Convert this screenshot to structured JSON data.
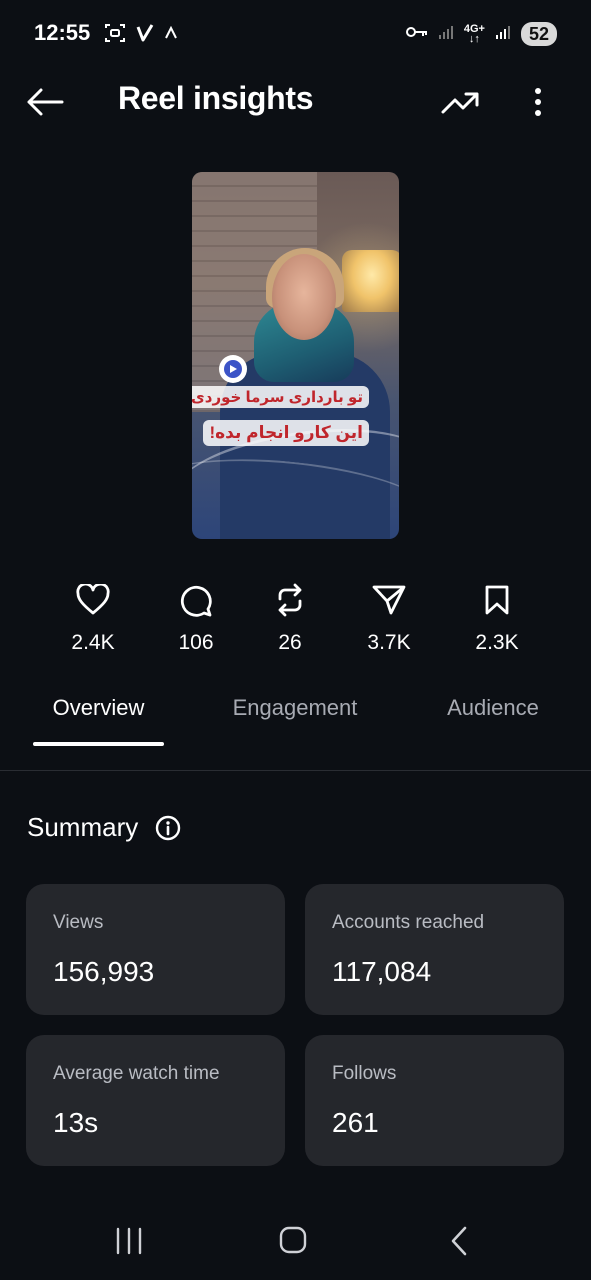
{
  "status_bar": {
    "time": "12:55",
    "network": "4G+",
    "battery": "52"
  },
  "header": {
    "title": "Reel insights"
  },
  "thumbnail": {
    "caption_line1": "تو بارداری سرما خوردی؟",
    "caption_line2": "این کارو انجام بده!"
  },
  "stats": [
    {
      "icon": "heart-icon",
      "value": "2.4K"
    },
    {
      "icon": "comment-icon",
      "value": "106"
    },
    {
      "icon": "repost-icon",
      "value": "26"
    },
    {
      "icon": "share-icon",
      "value": "3.7K"
    },
    {
      "icon": "bookmark-icon",
      "value": "2.3K"
    }
  ],
  "tabs": [
    {
      "label": "Overview",
      "active": true
    },
    {
      "label": "Engagement",
      "active": false
    },
    {
      "label": "Audience",
      "active": false
    }
  ],
  "summary": {
    "title": "Summary",
    "cards": [
      {
        "label": "Views",
        "value": "156,993"
      },
      {
        "label": "Accounts reached",
        "value": "117,084"
      },
      {
        "label": "Average watch time",
        "value": "13s"
      },
      {
        "label": "Follows",
        "value": "261"
      }
    ]
  },
  "colors": {
    "background": "#0c0f14",
    "card": "#25272c",
    "muted_text": "#b9bcc3"
  }
}
